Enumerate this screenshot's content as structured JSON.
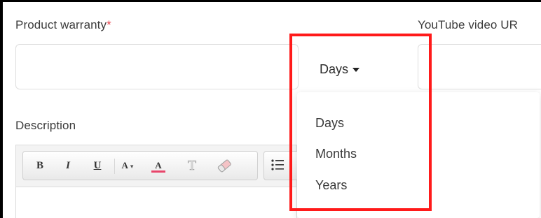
{
  "warranty": {
    "label": "Product warranty",
    "required_mark": "*",
    "unit_selected": "Days",
    "unit_options": [
      "Days",
      "Months",
      "Years"
    ]
  },
  "youtube": {
    "label": "YouTube video UR"
  },
  "description": {
    "label": "Description",
    "toolbar": {
      "bold": "B",
      "italic": "I",
      "underline": "U",
      "font_size": "A",
      "text_color": "A",
      "format_icon": "T"
    }
  },
  "colors": {
    "highlight": "#ff1a1a",
    "required": "#e8454f",
    "text_color_underline": "#e8456a"
  }
}
